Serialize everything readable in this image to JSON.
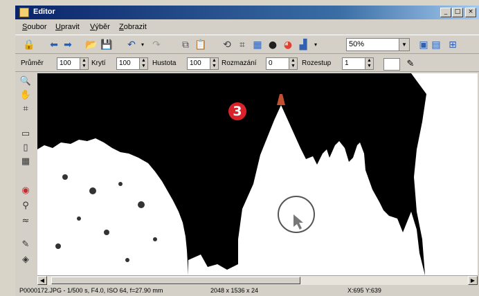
{
  "window": {
    "title": "Editor"
  },
  "menu": {
    "items": [
      "Soubor",
      "Upravit",
      "Výběr",
      "Zobrazit"
    ]
  },
  "toolbar": {
    "zoom": "50%"
  },
  "options": {
    "labels": [
      "Průměr",
      "Krytí",
      "Hustota",
      "Rozmazání",
      "Rozestup"
    ],
    "values": [
      "100",
      "100",
      "100",
      "0",
      "1"
    ]
  },
  "status": {
    "fileinfo": "P0000172.JPG - 1/500 s, F4.0, ISO 64, f=27.90 mm",
    "dimensions": "2048 x 1536 x 24",
    "coords": "X:695 Y:639"
  },
  "callout": {
    "number": "3"
  },
  "colors": {
    "titlebar": "#0a246a",
    "badge": "#d8232a",
    "canvas_background": "#000000"
  }
}
